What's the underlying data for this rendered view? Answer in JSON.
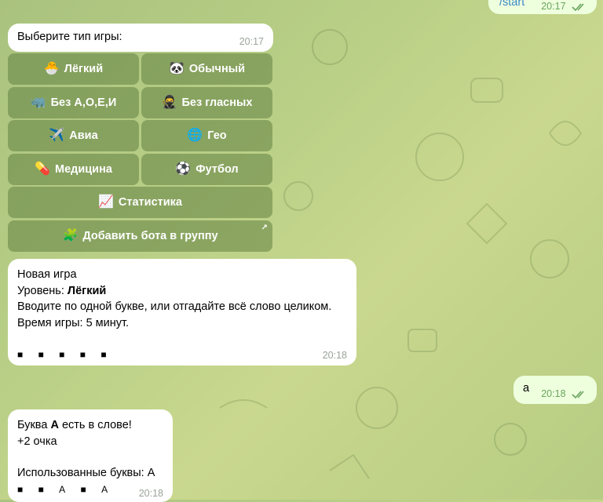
{
  "messages": {
    "start_cmd": {
      "text": "/start",
      "time": "20:17"
    },
    "choose": {
      "text": "Выберите тип игры:",
      "time": "20:17"
    },
    "keyboard": [
      {
        "emoji": "🐣",
        "label": "Лёгкий"
      },
      {
        "emoji": "🐼",
        "label": "Обычный"
      },
      {
        "emoji": "🦏",
        "label": "Без А,О,Е,И"
      },
      {
        "emoji": "🥷",
        "label": "Без гласных"
      },
      {
        "emoji": "✈️",
        "label": "Авиа"
      },
      {
        "emoji": "🌐",
        "label": "Гео"
      },
      {
        "emoji": "💊",
        "label": "Медицина"
      },
      {
        "emoji": "⚽",
        "label": "Футбол"
      },
      {
        "emoji": "📈",
        "label": "Статистика"
      },
      {
        "emoji": "🧩",
        "label": "Добавить бота в группу",
        "external_link_icon": "↗"
      }
    ],
    "new_game": {
      "line1": "Новая игра",
      "level_prefix": "Уровень: ",
      "level_value": "Лёгкий",
      "line3": "Вводите по одной букве, или отгадайте всё слово целиком.",
      "line4": "Время игры: 5 минут.",
      "mask": "■ ■ ■ ■ ■",
      "time": "20:18"
    },
    "user_letter": {
      "text": "а",
      "time": "20:18"
    },
    "letter_found": {
      "prefix": "Буква ",
      "letter": "А",
      "suffix": " есть в слове!",
      "points": "+2 очка",
      "used": "Использованные буквы: А",
      "mask": "■ ■ А ■ А",
      "time": "20:18"
    }
  },
  "colors": {
    "accent_out": "#eeffde",
    "check": "#6aa35d",
    "button_bg": "rgba(98,130,66,0.55)"
  }
}
